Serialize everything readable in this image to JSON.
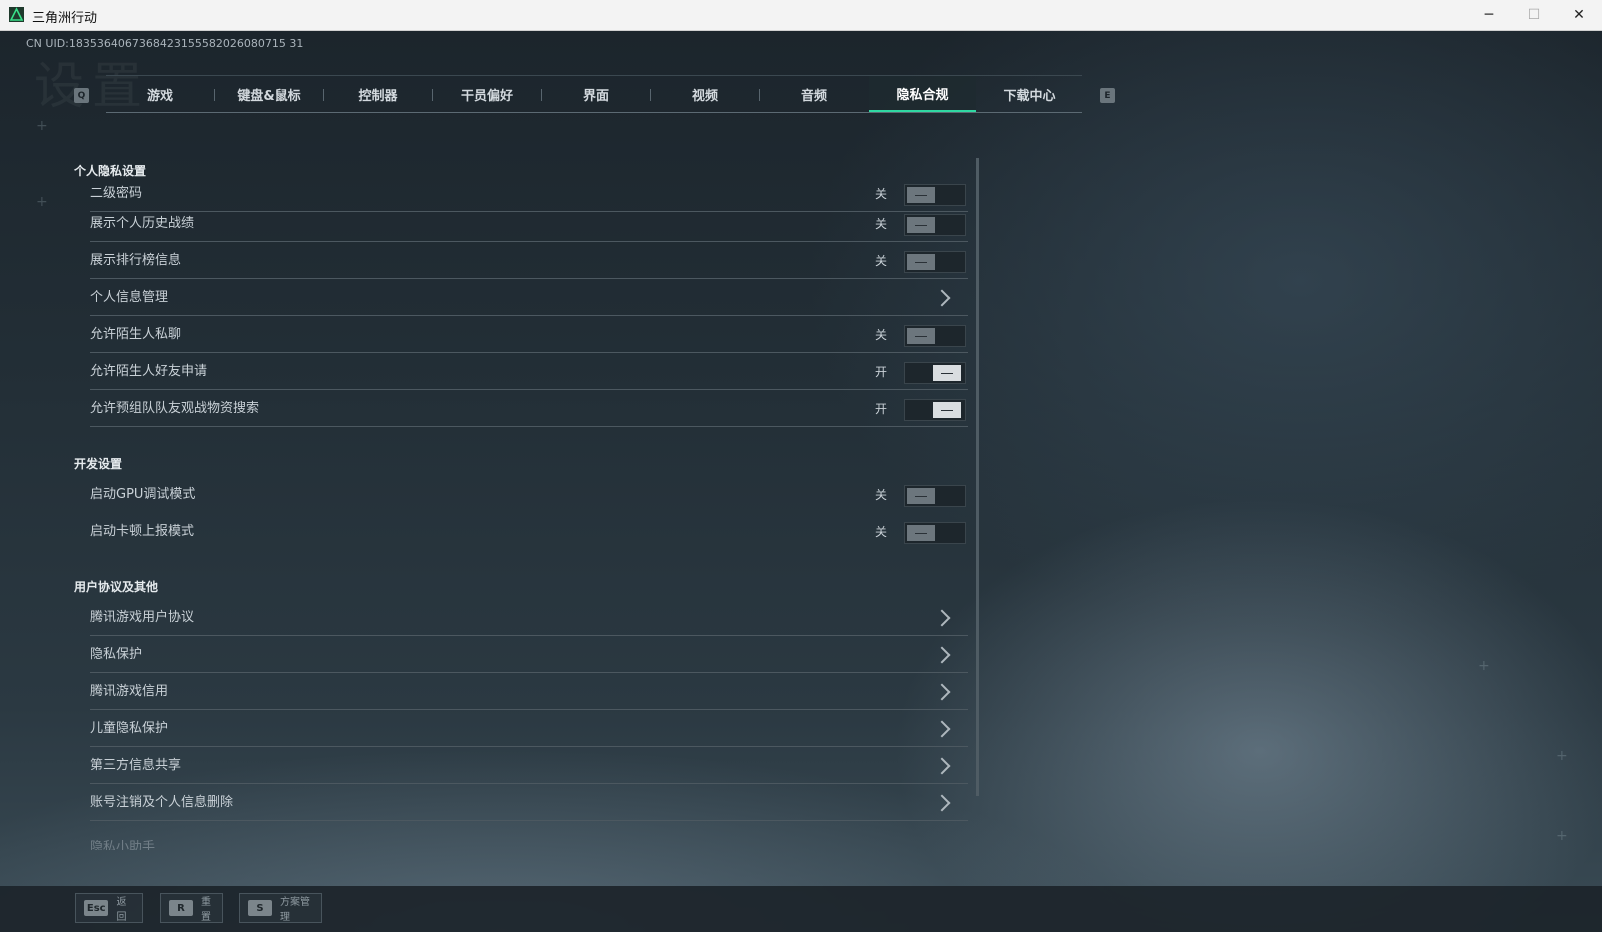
{
  "window": {
    "title": "三角洲行动",
    "min": "─",
    "max": "☐",
    "close": "✕"
  },
  "header": {
    "uid": "CN UID:1835364067368423155582026080715 31",
    "bg_word": "设置"
  },
  "tabs": {
    "prev_key": "Q",
    "next_key": "E",
    "items": [
      "游戏",
      "键盘&鼠标",
      "控制器",
      "干员偏好",
      "界面",
      "视频",
      "音频",
      "隐私合规",
      "下载中心"
    ],
    "active_index": 7
  },
  "sections": {
    "personal": {
      "title": "个人隐私设置",
      "rows": [
        {
          "label": "二级密码",
          "state": "关"
        },
        {
          "label": "展示个人历史战绩",
          "state": "关"
        },
        {
          "label": "展示排行榜信息",
          "state": "关"
        },
        {
          "label": "个人信息管理"
        },
        {
          "label": "允许陌生人私聊",
          "state": "关"
        },
        {
          "label": "允许陌生人好友申请",
          "state": "开"
        },
        {
          "label": "允许预组队队友观战物资搜索",
          "state": "开"
        }
      ]
    },
    "dev": {
      "title": "开发设置",
      "rows": [
        {
          "label": "启动GPU调试模式",
          "state": "关"
        },
        {
          "label": "启动卡顿上报模式",
          "state": "关"
        }
      ]
    },
    "agreements": {
      "title": "用户协议及其他",
      "rows": [
        {
          "label": "腾讯游戏用户协议"
        },
        {
          "label": "隐私保护"
        },
        {
          "label": "腾讯游戏信用"
        },
        {
          "label": "儿童隐私保护"
        },
        {
          "label": "第三方信息共享"
        },
        {
          "label": "账号注销及个人信息删除"
        },
        {
          "label": "隐私小助手"
        }
      ]
    }
  },
  "footer": {
    "back": {
      "key": "Esc",
      "label": "返回"
    },
    "reset": {
      "key": "R",
      "label": "重置"
    },
    "scheme": {
      "key": "S",
      "label": "方案管理"
    }
  }
}
